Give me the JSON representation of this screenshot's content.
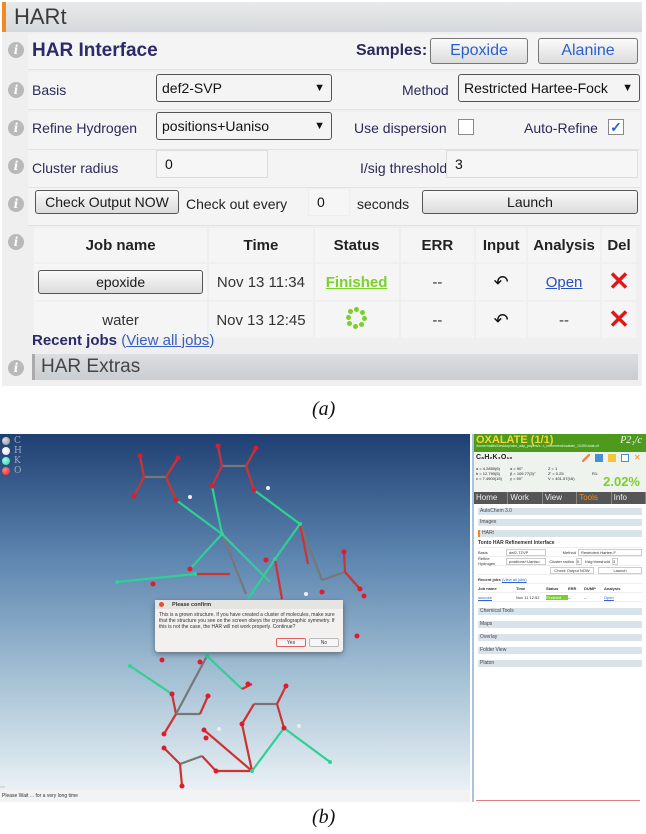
{
  "panel_a": {
    "section_title": "HARt",
    "interface_title": "HAR Interface",
    "samples_label": "Samples:",
    "sample_buttons": [
      "Epoxide",
      "Alanine"
    ],
    "basis_label": "Basis",
    "basis_value": "def2-SVP",
    "method_label": "Method",
    "method_value": "Restricted Hartee-Fock",
    "refine_h_label": "Refine Hydrogen",
    "refine_h_value": "positions+Uaniso",
    "dispersion_label": "Use dispersion",
    "dispersion_checked": false,
    "autorefine_label": "Auto-Refine",
    "autorefine_checked": true,
    "autorefine_mark": "✓",
    "cluster_label": "Cluster radius",
    "cluster_value": "0",
    "isig_label": "I/sig threshold",
    "isig_value": "3",
    "check_now_label": "Check Output NOW",
    "check_every_label": "Check out every",
    "check_every_value": "0",
    "seconds_label": "seconds",
    "launch_label": "Launch",
    "jobs_headers": [
      "Job name",
      "Time",
      "Status",
      "ERR",
      "Input",
      "Analysis",
      "Del"
    ],
    "jobs": [
      {
        "name": "epoxide",
        "time": "Nov 13 11:34",
        "status": "Finished",
        "err": "--",
        "input_icon": "↶",
        "analysis": "Open",
        "del": "✕"
      },
      {
        "name": "water",
        "time": "Nov 13 12:45",
        "status": "running",
        "err": "--",
        "input_icon": "↶",
        "analysis": "--",
        "del": "✕"
      }
    ],
    "recent_label": "Recent jobs",
    "view_all_open": "(",
    "view_all_label": "View all jobs",
    "view_all_close": ")",
    "extras_title": "HAR Extras",
    "info_glyph": "i",
    "caption": "(a)"
  },
  "panel_b": {
    "legend": [
      {
        "el": "C",
        "color": "#8a8f98"
      },
      {
        "el": "H",
        "color": "#f2f2f2"
      },
      {
        "el": "K",
        "color": "#2fd39a"
      },
      {
        "el": "O",
        "color": "#e21b2b"
      }
    ],
    "dialog": {
      "title": "Please confirm",
      "body": "This is a grown structure. If you have created a cluster of molecules, make sure that the structure you see on the screen obeys the crystallographic symmetry. If this is not the case, the HAR will not work properly. Continue?",
      "yes": "Yes",
      "no": "No"
    },
    "cmd_prompt": ">>",
    "status_text": "Please Wait ... for a very long time",
    "side": {
      "title": "OXALATE (1/1)",
      "space_group": "P2₁/c",
      "path": "/home/mattis/Desktop/olex_adp_papers/x...t_refinement/oxalate_13490.total.cif",
      "formula": "C₈H₂K₄O₁₆",
      "cell_a": [
        "a = 4.2850(6)",
        "b = 12.790(5)",
        "c = 7.4900(15)"
      ],
      "cell_b": [
        "α = 90°",
        "β = 109.77(3)°",
        "γ = 90°"
      ],
      "cell_c": [
        "Z = 1",
        "Z' = 0.25",
        "V = 401.57(16)"
      ],
      "r_label": "R1:",
      "r_value": "2.02%",
      "tabs": [
        "Home",
        "Work",
        "View",
        "Tools",
        "Info"
      ],
      "active_tab": "Tools",
      "sections_top": [
        "AutoChem 3.0",
        "Images"
      ],
      "hart_title": "HARt",
      "hart_sub": "Tonto HAR Refinement Interface",
      "mini_basis_label": "Basis",
      "mini_basis": "def2-TZVP",
      "mini_method_label": "Method",
      "mini_method": "Restricted Hartee-F",
      "mini_refine_label": "Refine Hydrogen",
      "mini_refine": "positions+Uaniso",
      "mini_cluster_label": "Cluster radius",
      "mini_cluster": "0",
      "mini_isig_label": "I/sig threshold",
      "mini_isig": "3",
      "mini_check": "Check Output NOW",
      "mini_launch": "Launch",
      "mini_recent": "Recent jobs",
      "mini_viewall": "(View all jobs)",
      "mini_headers": [
        "Job name",
        "Time",
        "Status",
        "ERR",
        "DUMP",
        "Analysis"
      ],
      "mini_row": [
        "sucrose",
        "Nov 11 12:52",
        "Finished",
        "--",
        "--",
        "Open"
      ],
      "sections_bottom": [
        "Chemical Tools",
        "Maps",
        "Overlay",
        "Folder View",
        "Platon"
      ]
    },
    "caption": "(b)"
  }
}
